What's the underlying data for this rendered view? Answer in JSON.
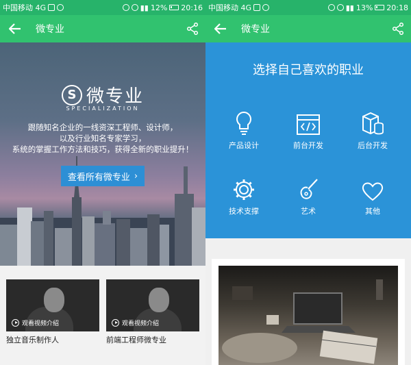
{
  "statusbar_left": {
    "carrier": "中国移动 4G",
    "battery": "12%",
    "time": "20:16"
  },
  "statusbar_right": {
    "carrier": "中国移动 4G",
    "battery": "13%",
    "time": "20:18"
  },
  "appbar": {
    "title": "微专业"
  },
  "hero": {
    "logo_text": "微专业",
    "logo_sub": "SPECIALIZATION",
    "lines": [
      "跟随知名企业的一线资深工程师、设计师，",
      "以及行业知名专家学习，",
      "系统的掌握工作方法和技巧，获得全新的职业提升！"
    ],
    "button_label": "查看所有微专业",
    "button_arrow": "›"
  },
  "cards": [
    {
      "play_label": "观看视频介绍",
      "title": "独立音乐制作人"
    },
    {
      "play_label": "观看视频介绍",
      "title": "前端工程师微专业"
    }
  ],
  "careers": {
    "heading": "选择自己喜欢的职业",
    "items": [
      {
        "label": "产品设计",
        "icon": "lightbulb-icon"
      },
      {
        "label": "前台开发",
        "icon": "code-window-icon"
      },
      {
        "label": "后台开发",
        "icon": "database-icon"
      },
      {
        "label": "技术支撑",
        "icon": "gear-icon"
      },
      {
        "label": "艺术",
        "icon": "guitar-icon"
      },
      {
        "label": "其他",
        "icon": "heart-icon"
      }
    ]
  },
  "colors": {
    "green_dark": "#27b36a",
    "green": "#31c26f",
    "blue": "#2b93d8",
    "button_blue": "#2d8fd5"
  }
}
